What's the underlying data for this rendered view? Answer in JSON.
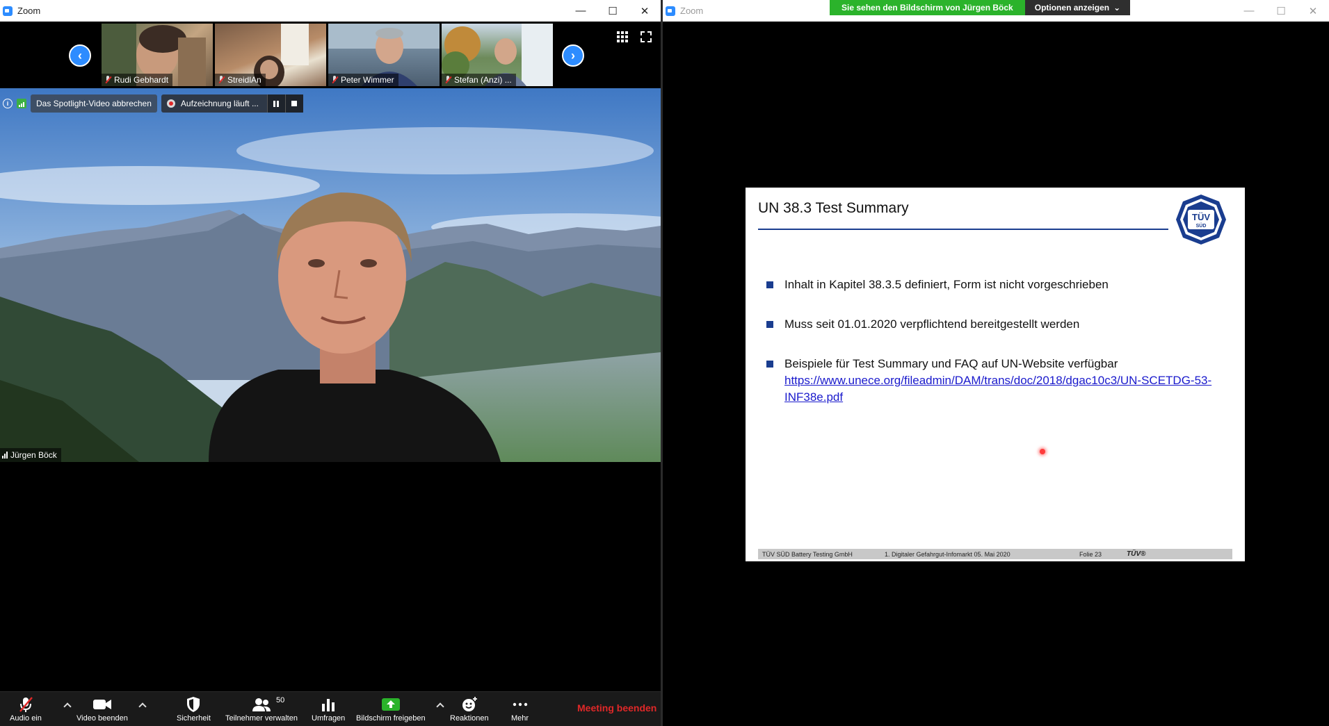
{
  "left_window": {
    "title": "Zoom",
    "controls": [
      "—",
      "☐",
      "✕"
    ]
  },
  "right_window": {
    "title": "Zoom",
    "controls": [
      "—",
      "☐",
      "✕"
    ],
    "share_banner": "Sie sehen den Bildschirm von Jürgen Böck",
    "view_options": "Optionen anzeigen"
  },
  "thumbnails": [
    {
      "name": "Rudi Gebhardt"
    },
    {
      "name": "StreidlAn"
    },
    {
      "name": "Peter Wimmer"
    },
    {
      "name": "Stefan (Anzi) ..."
    }
  ],
  "spotlight": {
    "cancel_label": "Das Spotlight-Video abbrechen",
    "recording_label": "Aufzeichnung läuft ...",
    "speaker": "Jürgen Böck"
  },
  "toolbar": {
    "audio": "Audio ein",
    "video": "Video beenden",
    "security": "Sicherheit",
    "participants": "Teilnehmer verwalten",
    "participants_count": "50",
    "polls": "Umfragen",
    "share": "Bildschirm freigeben",
    "reactions": "Reaktionen",
    "more": "Mehr",
    "end": "Meeting beenden"
  },
  "slide": {
    "title": "UN 38.3 Test Summary",
    "logo_text": "TÜV SÜD",
    "bullets": [
      "Inhalt in Kapitel 38.3.5 definiert, Form ist nicht vorgeschrieben",
      "Muss seit 01.01.2020 verpflichtend bereitgestellt werden",
      "Beispiele für Test Summary und FAQ auf UN-Website verfügbar"
    ],
    "link": "https://www.unece.org/fileadmin/DAM/trans/doc/2018/dgac10c3/UN-SCETDG-53-INF38e.pdf",
    "footer_left": "TÜV SÜD Battery Testing GmbH",
    "footer_center": "1. Digitaler Gefahrgut-Infomarkt 05. Mai 2020",
    "footer_page": "Folie 23",
    "footer_logo": "TÜV®"
  },
  "colors": {
    "zoom_blue": "#2d8cff",
    "share_green": "#2bb32b",
    "end_red": "#e02828",
    "slide_blue": "#1a3d8f"
  }
}
